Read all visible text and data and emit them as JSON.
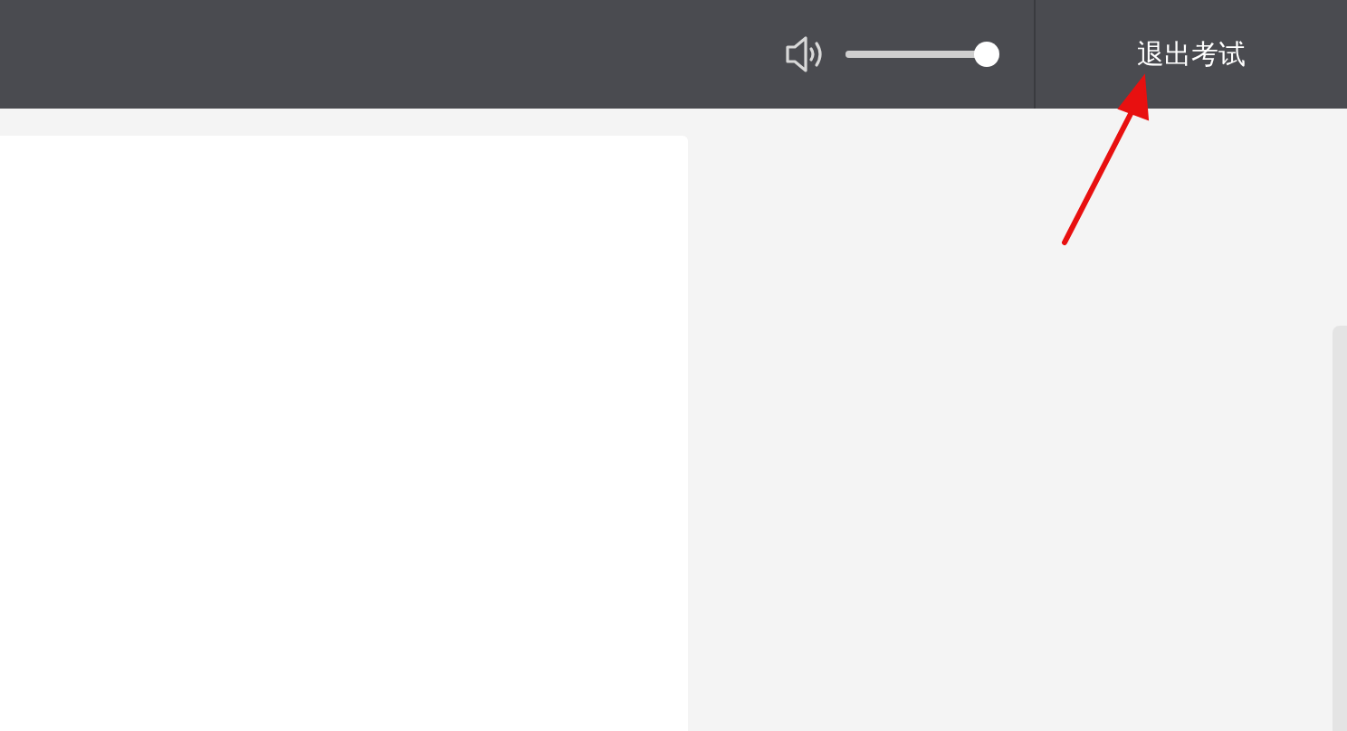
{
  "header": {
    "volume": {
      "level": 0.98
    },
    "exit_button": {
      "label": "退出考试"
    }
  }
}
